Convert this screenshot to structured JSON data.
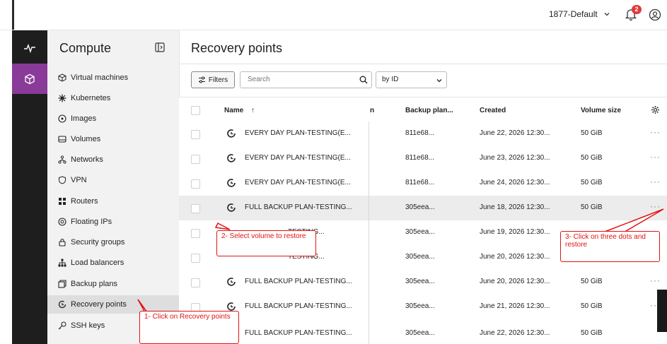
{
  "topbar": {
    "project": "1877-Default",
    "notifications": "2"
  },
  "sidebar": {
    "title": "Compute",
    "items": [
      {
        "label": "Virtual machines",
        "icon": "cube-icon"
      },
      {
        "label": "Kubernetes",
        "icon": "helm-icon"
      },
      {
        "label": "Images",
        "icon": "disc-icon"
      },
      {
        "label": "Volumes",
        "icon": "drive-icon"
      },
      {
        "label": "Networks",
        "icon": "network-icon"
      },
      {
        "label": "VPN",
        "icon": "shield-icon"
      },
      {
        "label": "Routers",
        "icon": "router-icon"
      },
      {
        "label": "Floating IPs",
        "icon": "globe-icon"
      },
      {
        "label": "Security groups",
        "icon": "lock-icon"
      },
      {
        "label": "Load balancers",
        "icon": "sitemap-icon"
      },
      {
        "label": "Backup plans",
        "icon": "copy-icon"
      },
      {
        "label": "Recovery points",
        "icon": "restore-icon"
      },
      {
        "label": "SSH keys",
        "icon": "key-icon"
      }
    ]
  },
  "main": {
    "title": "Recovery points",
    "filters_label": "Filters",
    "search_placeholder": "Search",
    "sort_select": "by ID"
  },
  "table": {
    "headers": {
      "name": "Name",
      "sort_arrow": "↑",
      "hidden_col": "n",
      "backup_plan": "Backup plan...",
      "created": "Created",
      "volume_size": "Volume size"
    },
    "rows": [
      {
        "name": "EVERY DAY PLAN-TESTING(E...",
        "backup_plan": "811e68...",
        "created": "June 22, 2026 12:30...",
        "volume_size": "50 GiB",
        "actions": "···"
      },
      {
        "name": "EVERY DAY PLAN-TESTING(E...",
        "backup_plan": "811e68...",
        "created": "June 23, 2026 12:30...",
        "volume_size": "50 GiB",
        "actions": "···"
      },
      {
        "name": "EVERY DAY PLAN-TESTING(E...",
        "backup_plan": "811e68...",
        "created": "June 24, 2026 12:30...",
        "volume_size": "50 GiB",
        "actions": "···"
      },
      {
        "name": "FULL BACKUP PLAN-TESTING...",
        "backup_plan": "305eea...",
        "created": "June 18, 2026 12:30...",
        "volume_size": "50 GiB",
        "actions": "···"
      },
      {
        "name": "TESTING...",
        "backup_plan": "305eea...",
        "created": "June 19, 2026 12:30...",
        "volume_size": "",
        "actions": ""
      },
      {
        "name": "TESTING...",
        "backup_plan": "305eea...",
        "created": "June 20, 2026 12:30...",
        "volume_size": "",
        "actions": ""
      },
      {
        "name": "FULL BACKUP PLAN-TESTING...",
        "backup_plan": "305eea...",
        "created": "June 20, 2026 12:30...",
        "volume_size": "50 GiB",
        "actions": "···"
      },
      {
        "name": "FULL BACKUP PLAN-TESTING...",
        "backup_plan": "305eea...",
        "created": "June 21, 2026 12:30...",
        "volume_size": "50 GiB",
        "actions": "···"
      },
      {
        "name": "FULL BACKUP PLAN-TESTING...",
        "backup_plan": "305eea...",
        "created": "June 22, 2026 12:30...",
        "volume_size": "50 GiB",
        "actions": "···"
      }
    ]
  },
  "annotations": {
    "step1": "1- Click on Recovery points",
    "step2": "2- Select volume to restore",
    "step3": "3- Click on three dots and restore"
  },
  "colors": {
    "accent": "#8a3a98",
    "annotation": "#e01414",
    "badge": "#e03a3a"
  }
}
